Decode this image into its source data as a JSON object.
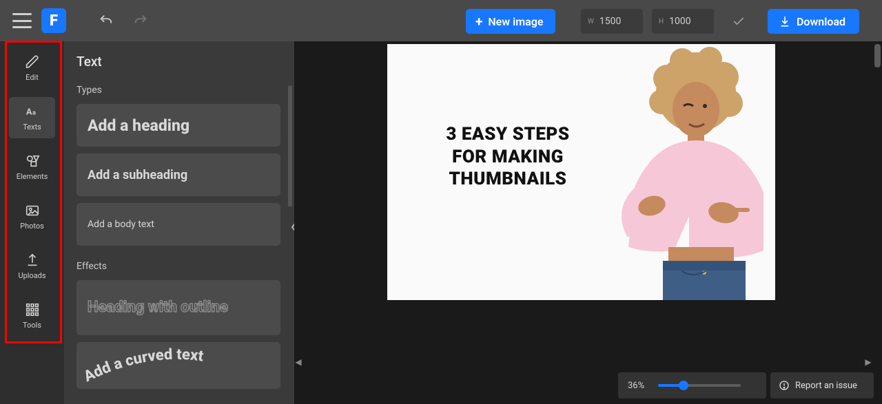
{
  "topbar": {
    "brand_letter": "F",
    "new_image_label": "New image",
    "width": "1500",
    "height": "1000",
    "download_label": "Download"
  },
  "rail": {
    "items": [
      {
        "label": "Edit",
        "icon": "pencil-icon"
      },
      {
        "label": "Texts",
        "icon": "text-icon"
      },
      {
        "label": "Elements",
        "icon": "shapes-icon"
      },
      {
        "label": "Photos",
        "icon": "photo-icon"
      },
      {
        "label": "Uploads",
        "icon": "upload-icon"
      },
      {
        "label": "Tools",
        "icon": "grid-icon"
      }
    ],
    "active_index": 1
  },
  "panel": {
    "title": "Text",
    "types_label": "Types",
    "effects_label": "Effects",
    "types": {
      "heading": "Add a heading",
      "subheading": "Add a subheading",
      "body": "Add a body text"
    },
    "effects": {
      "outline": "Heading with outline",
      "curved": "Add a curved text"
    }
  },
  "canvas": {
    "text_line1": "3 EASY STEPS",
    "text_line2": "FOR MAKING",
    "text_line3": "THUMBNAILS"
  },
  "status": {
    "zoom": "36%",
    "report_label": "Report an issue"
  },
  "colors": {
    "accent": "#1877ff",
    "highlight": "#ff0000"
  }
}
